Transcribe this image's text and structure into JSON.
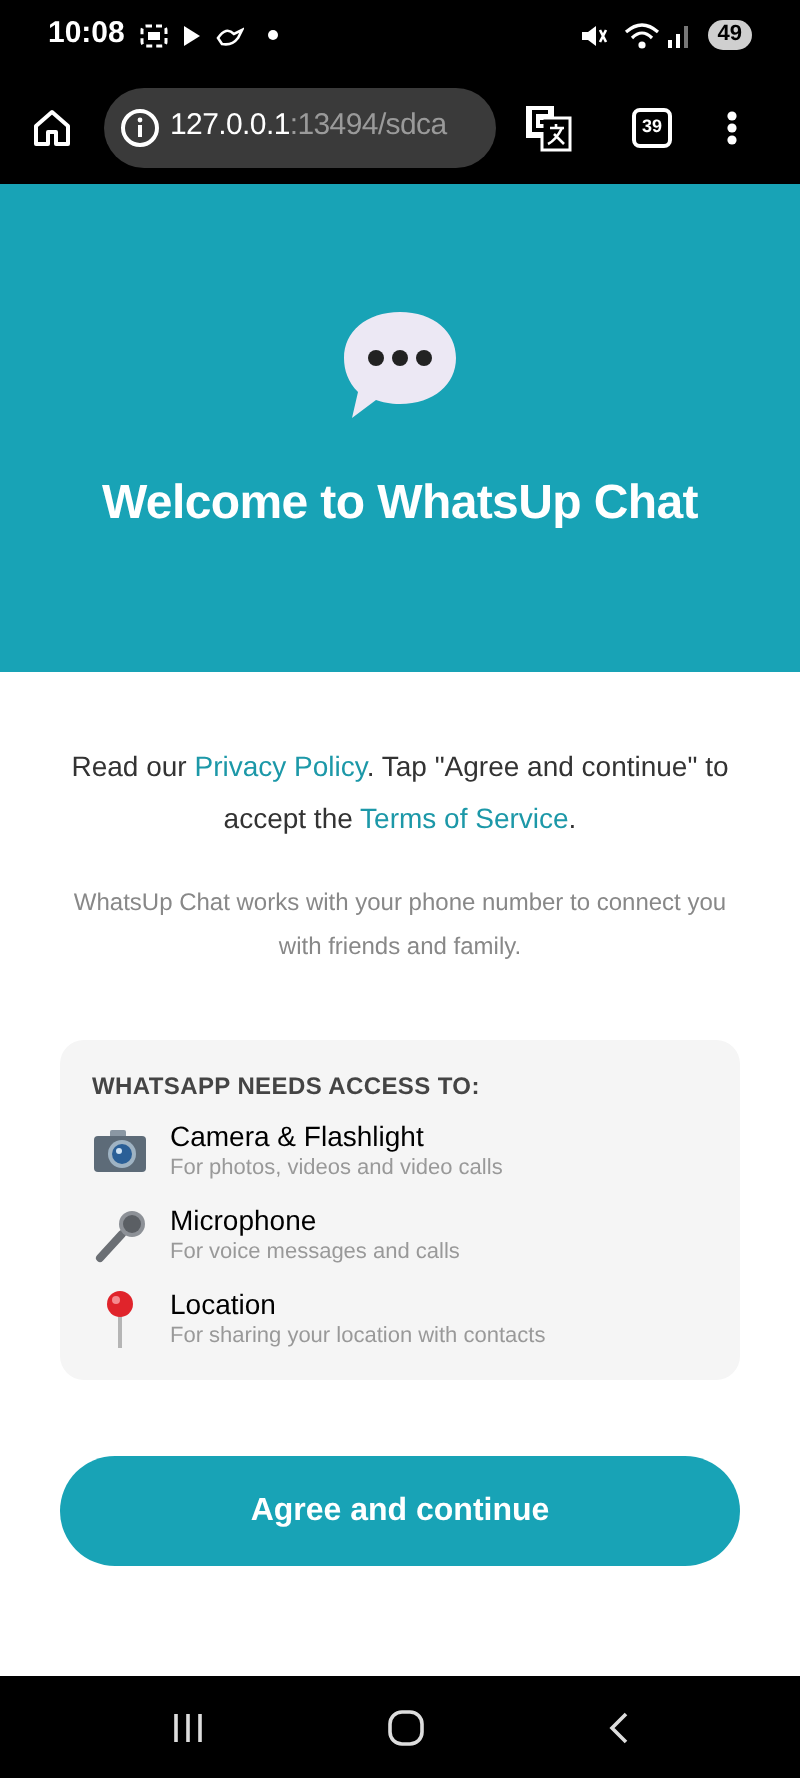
{
  "status_bar": {
    "time": "10:08",
    "battery": "49"
  },
  "browser": {
    "url_host": "127.0.0.1",
    "url_rest": ":13494/sdca",
    "tab_count": "39"
  },
  "header": {
    "title": "Welcome to WhatsUp Chat"
  },
  "intro": [
    {
      "text": "Read our ",
      "link": false
    },
    {
      "text": "Privacy Policy",
      "link": true
    },
    {
      "text": ". Tap \"Agree and continue\" to accept the ",
      "link": false
    },
    {
      "text": "Terms of Service",
      "link": true
    },
    {
      "text": ".",
      "link": false
    }
  ],
  "description": "WhatsUp Chat works with your phone number to connect you with friends and family.",
  "permissions": {
    "heading": "WHATSAPP NEEDS ACCESS TO:",
    "items": [
      {
        "kind": "camera",
        "title": "Camera & Flashlight",
        "subtitle": "For photos, videos and video calls"
      },
      {
        "kind": "microphone",
        "title": "Microphone",
        "subtitle": "For voice messages and calls"
      },
      {
        "kind": "location",
        "title": "Location",
        "subtitle": "For sharing your location with contacts"
      }
    ]
  },
  "agree_button": "Agree and continue"
}
